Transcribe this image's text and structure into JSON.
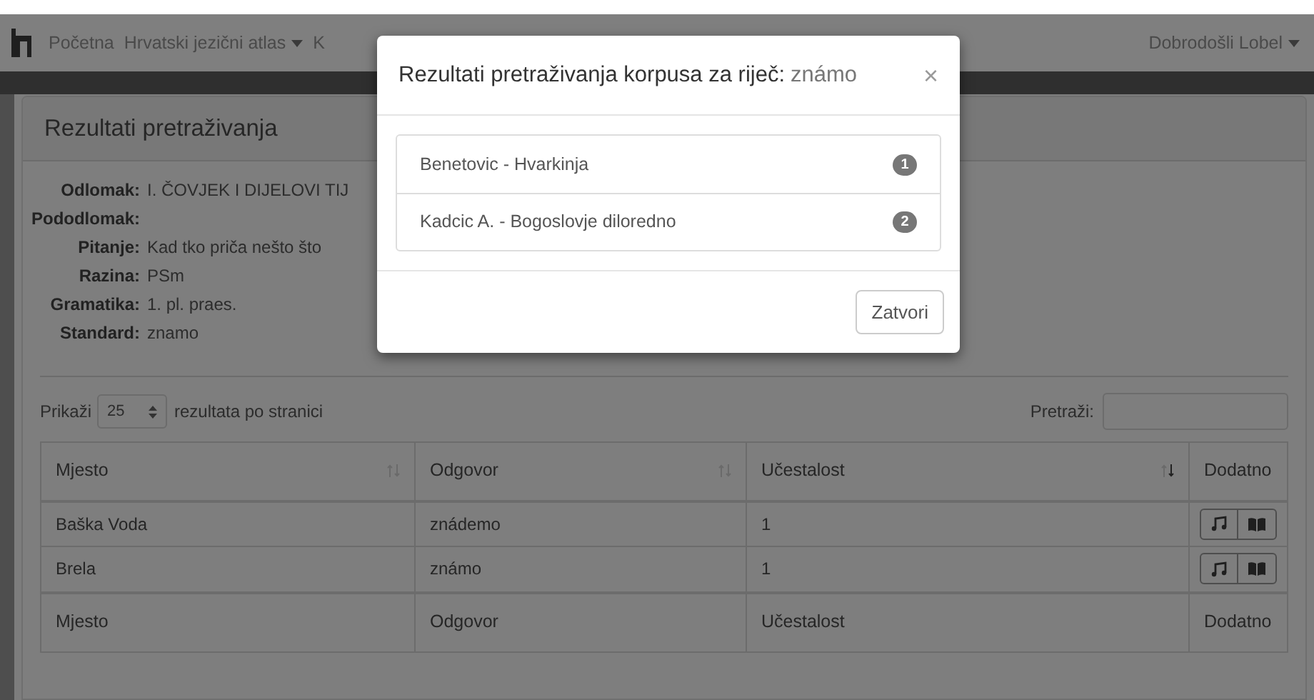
{
  "navbar": {
    "items": [
      {
        "label": "Početna",
        "dropdown": false
      },
      {
        "label": "Hrvatski jezični atlas",
        "dropdown": true
      },
      {
        "label": "K",
        "dropdown": false
      }
    ],
    "user": {
      "label": "Dobrodošli Lobel",
      "dropdown": true
    }
  },
  "card": {
    "title": "Rezultati pretraživanja",
    "details": [
      {
        "label": "Odlomak:",
        "value": "I. ČOVJEK I DIJELOVI TIJ"
      },
      {
        "label": "Pododlomak:"
      },
      {
        "label": "Pitanje:",
        "value": "Kad tko priča nešto što"
      },
      {
        "label": "Razina:",
        "value": "PSm"
      },
      {
        "label": "Gramatika:",
        "value": "1. pl. praes."
      },
      {
        "label": "Standard:",
        "value": "znamo"
      }
    ],
    "length": {
      "before": "Prikaži",
      "value": "25",
      "after": "rezultata po stranici"
    },
    "search": {
      "label": "Pretraži:"
    },
    "table": {
      "columns": [
        {
          "label": "Mjesto",
          "sortable": true,
          "sorted": false
        },
        {
          "label": "Odgovor",
          "sortable": true,
          "sorted": false
        },
        {
          "label": "Učestalost",
          "sortable": true,
          "sorted": true
        },
        {
          "label": "Dodatno",
          "sortable": false
        }
      ],
      "rows": [
        [
          "Baška Voda",
          "znádemo",
          "1"
        ],
        [
          "Brela",
          "známo",
          "1"
        ]
      ],
      "footer": [
        "Mjesto",
        "Odgovor",
        "Učestalost",
        "Dodatno"
      ]
    }
  },
  "modal": {
    "title": "Rezultati pretraživanja korpusa za riječ:",
    "word": "známo",
    "close": "×",
    "items": [
      {
        "label": "Benetovic - Hvarkinja",
        "badge": "1"
      },
      {
        "label": "Kadcic A. - Bogoslovje diloredno",
        "badge": "2"
      }
    ],
    "button": "Zatvori"
  }
}
